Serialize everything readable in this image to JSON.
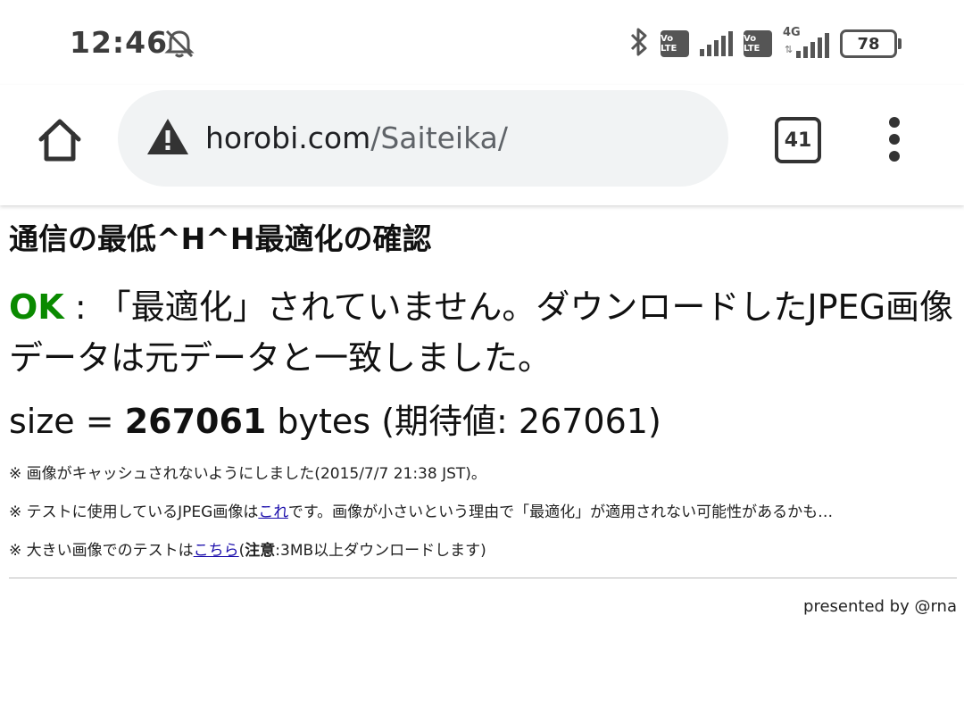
{
  "statusbar": {
    "time": "12:46",
    "volte_label": "Vo LTE",
    "network_label": "4G",
    "battery": "78"
  },
  "browser": {
    "url_domain": "horobi.com",
    "url_path": "/Saiteika/",
    "tab_count": "41"
  },
  "page": {
    "title": "通信の最低^H^H最適化の確認",
    "result_status": "OK",
    "result_text": " : 「最適化」されていません。ダウンロードしたJPEG画像データは元データと一致しました。",
    "size_prefix": "size = ",
    "size_value": "267061",
    "size_suffix": " bytes (期待値: 267061)",
    "note1": "※ 画像がキャッシュされないようにしました(2015/7/7 21:38 JST)。",
    "note2_prefix": "※ テストに使用しているJPEG画像は",
    "note2_link": "これ",
    "note2_suffix": "です。画像が小さいという理由で「最適化」が適用されない可能性があるかも…",
    "note3_prefix": "※ 大きい画像でのテストは",
    "note3_link": "こちら",
    "note3_paren_open": "(",
    "note3_bold": "注意",
    "note3_suffix": ":3MB以上ダウンロードします)",
    "footer": "presented by @rna"
  }
}
